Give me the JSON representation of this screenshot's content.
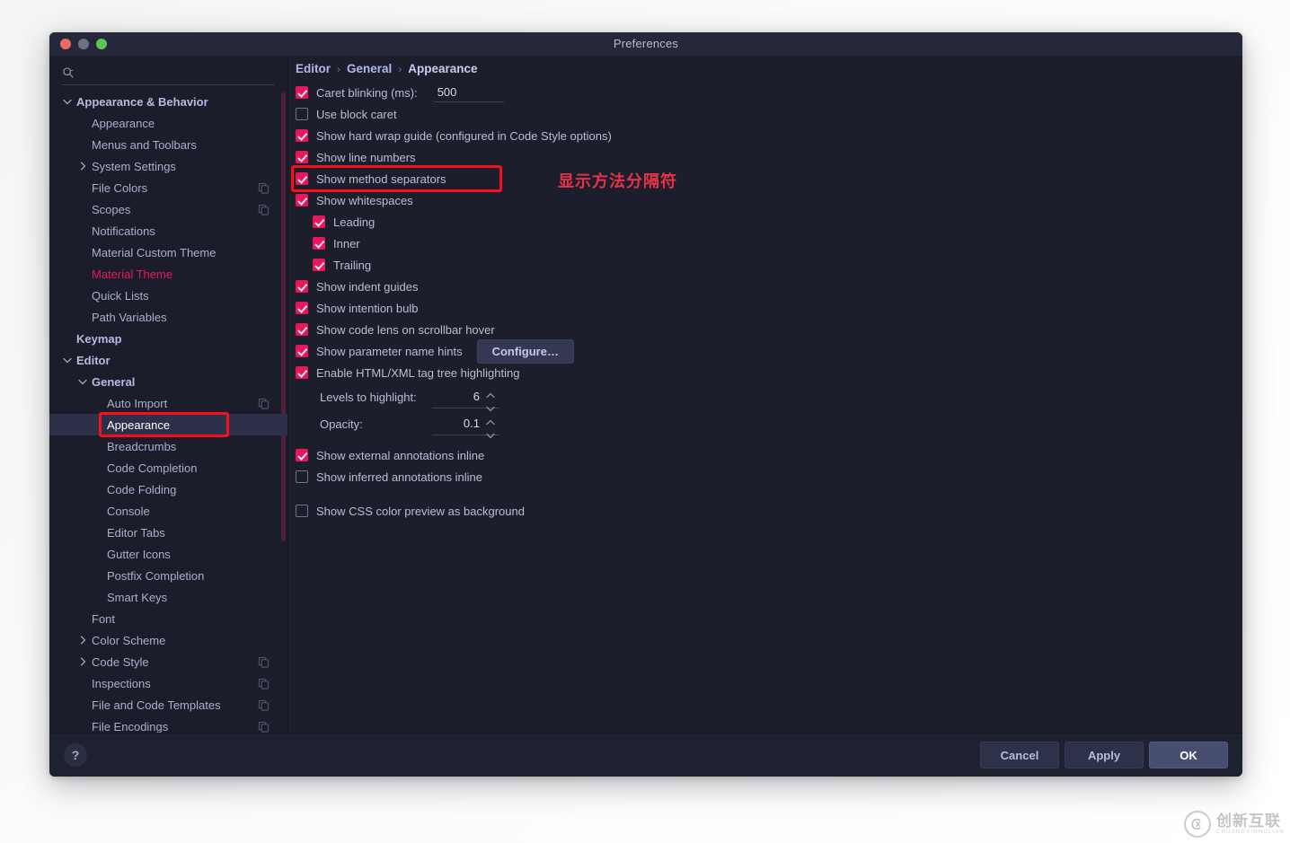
{
  "window": {
    "title": "Preferences",
    "traffic_lights": [
      "close-button",
      "minimize-button",
      "zoom-button"
    ]
  },
  "search": {
    "value": "",
    "placeholder": ""
  },
  "sidebar": {
    "items": [
      {
        "label": "Appearance & Behavior",
        "depth": 0,
        "bold": true,
        "chevron": "down",
        "icon": null,
        "selected": false,
        "accent": false
      },
      {
        "label": "Appearance",
        "depth": 1,
        "bold": false,
        "chevron": null,
        "icon": null,
        "selected": false,
        "accent": false
      },
      {
        "label": "Menus and Toolbars",
        "depth": 1,
        "bold": false,
        "chevron": null,
        "icon": null,
        "selected": false,
        "accent": false
      },
      {
        "label": "System Settings",
        "depth": 1,
        "bold": false,
        "chevron": "right",
        "icon": null,
        "selected": false,
        "accent": false
      },
      {
        "label": "File Colors",
        "depth": 1,
        "bold": false,
        "chevron": null,
        "icon": "copy-icon",
        "selected": false,
        "accent": false
      },
      {
        "label": "Scopes",
        "depth": 1,
        "bold": false,
        "chevron": null,
        "icon": "copy-icon",
        "selected": false,
        "accent": false
      },
      {
        "label": "Notifications",
        "depth": 1,
        "bold": false,
        "chevron": null,
        "icon": null,
        "selected": false,
        "accent": false
      },
      {
        "label": "Material Custom Theme",
        "depth": 1,
        "bold": false,
        "chevron": null,
        "icon": null,
        "selected": false,
        "accent": false
      },
      {
        "label": "Material Theme",
        "depth": 1,
        "bold": false,
        "chevron": null,
        "icon": null,
        "selected": false,
        "accent": true
      },
      {
        "label": "Quick Lists",
        "depth": 1,
        "bold": false,
        "chevron": null,
        "icon": null,
        "selected": false,
        "accent": false
      },
      {
        "label": "Path Variables",
        "depth": 1,
        "bold": false,
        "chevron": null,
        "icon": null,
        "selected": false,
        "accent": false
      },
      {
        "label": "Keymap",
        "depth": 0,
        "bold": true,
        "chevron": null,
        "icon": null,
        "selected": false,
        "accent": false
      },
      {
        "label": "Editor",
        "depth": 0,
        "bold": true,
        "chevron": "down",
        "icon": null,
        "selected": false,
        "accent": false
      },
      {
        "label": "General",
        "depth": 1,
        "bold": true,
        "chevron": "down",
        "icon": null,
        "selected": false,
        "accent": false
      },
      {
        "label": "Auto Import",
        "depth": 2,
        "bold": false,
        "chevron": null,
        "icon": "copy-icon",
        "selected": false,
        "accent": false
      },
      {
        "label": "Appearance",
        "depth": 2,
        "bold": false,
        "chevron": null,
        "icon": null,
        "selected": true,
        "accent": false
      },
      {
        "label": "Breadcrumbs",
        "depth": 2,
        "bold": false,
        "chevron": null,
        "icon": null,
        "selected": false,
        "accent": false
      },
      {
        "label": "Code Completion",
        "depth": 2,
        "bold": false,
        "chevron": null,
        "icon": null,
        "selected": false,
        "accent": false
      },
      {
        "label": "Code Folding",
        "depth": 2,
        "bold": false,
        "chevron": null,
        "icon": null,
        "selected": false,
        "accent": false
      },
      {
        "label": "Console",
        "depth": 2,
        "bold": false,
        "chevron": null,
        "icon": null,
        "selected": false,
        "accent": false
      },
      {
        "label": "Editor Tabs",
        "depth": 2,
        "bold": false,
        "chevron": null,
        "icon": null,
        "selected": false,
        "accent": false
      },
      {
        "label": "Gutter Icons",
        "depth": 2,
        "bold": false,
        "chevron": null,
        "icon": null,
        "selected": false,
        "accent": false
      },
      {
        "label": "Postfix Completion",
        "depth": 2,
        "bold": false,
        "chevron": null,
        "icon": null,
        "selected": false,
        "accent": false
      },
      {
        "label": "Smart Keys",
        "depth": 2,
        "bold": false,
        "chevron": null,
        "icon": null,
        "selected": false,
        "accent": false
      },
      {
        "label": "Font",
        "depth": 1,
        "bold": false,
        "chevron": null,
        "icon": null,
        "selected": false,
        "accent": false
      },
      {
        "label": "Color Scheme",
        "depth": 1,
        "bold": false,
        "chevron": "right",
        "icon": null,
        "selected": false,
        "accent": false
      },
      {
        "label": "Code Style",
        "depth": 1,
        "bold": false,
        "chevron": "right",
        "icon": "copy-icon",
        "selected": false,
        "accent": false
      },
      {
        "label": "Inspections",
        "depth": 1,
        "bold": false,
        "chevron": null,
        "icon": "copy-icon",
        "selected": false,
        "accent": false
      },
      {
        "label": "File and Code Templates",
        "depth": 1,
        "bold": false,
        "chevron": null,
        "icon": "copy-icon",
        "selected": false,
        "accent": false
      },
      {
        "label": "File Encodings",
        "depth": 1,
        "bold": false,
        "chevron": null,
        "icon": "copy-icon",
        "selected": false,
        "accent": false
      }
    ]
  },
  "breadcrumb": {
    "parts": [
      "Editor",
      "General",
      "Appearance"
    ],
    "separator": "›"
  },
  "options": [
    {
      "kind": "checkbox",
      "label": "Caret blinking (ms):",
      "checked": true,
      "indent": 0,
      "field": "500"
    },
    {
      "kind": "checkbox",
      "label": "Use block caret",
      "checked": false,
      "indent": 0
    },
    {
      "kind": "checkbox",
      "label": "Show hard wrap guide (configured in Code Style options)",
      "checked": true,
      "indent": 0
    },
    {
      "kind": "checkbox",
      "label": "Show line numbers",
      "checked": true,
      "indent": 0
    },
    {
      "kind": "checkbox",
      "label": "Show method separators",
      "checked": true,
      "indent": 0,
      "highlighted": true
    },
    {
      "kind": "checkbox",
      "label": "Show whitespaces",
      "checked": true,
      "indent": 0
    },
    {
      "kind": "checkbox",
      "label": "Leading",
      "checked": true,
      "indent": 1
    },
    {
      "kind": "checkbox",
      "label": "Inner",
      "checked": true,
      "indent": 1
    },
    {
      "kind": "checkbox",
      "label": "Trailing",
      "checked": true,
      "indent": 1
    },
    {
      "kind": "checkbox",
      "label": "Show indent guides",
      "checked": true,
      "indent": 0
    },
    {
      "kind": "checkbox",
      "label": "Show intention bulb",
      "checked": true,
      "indent": 0
    },
    {
      "kind": "checkbox",
      "label": "Show code lens on scrollbar hover",
      "checked": true,
      "indent": 0
    },
    {
      "kind": "checkbox",
      "label": "Show parameter name hints",
      "checked": true,
      "indent": 0,
      "button": "Configure…"
    },
    {
      "kind": "checkbox",
      "label": "Enable HTML/XML tag tree highlighting",
      "checked": true,
      "indent": 0
    }
  ],
  "spinners": [
    {
      "label": "Levels to highlight:",
      "value": "6"
    },
    {
      "label": "Opacity:",
      "value": "0.1"
    }
  ],
  "options_tail": [
    {
      "kind": "checkbox",
      "label": "Show external annotations inline",
      "checked": true,
      "indent": 0
    },
    {
      "kind": "checkbox",
      "label": "Show inferred annotations inline",
      "checked": false,
      "indent": 0
    },
    {
      "kind": "spacer"
    },
    {
      "kind": "checkbox",
      "label": "Show CSS color preview as background",
      "checked": false,
      "indent": 0
    }
  ],
  "annotation": {
    "text": "显示方法分隔符",
    "color": "#e8324a"
  },
  "footer": {
    "help_label": "?",
    "cancel_label": "Cancel",
    "apply_label": "Apply",
    "ok_label": "OK"
  },
  "watermark": {
    "glyph": "ⓧ",
    "cn": "创新互联",
    "en": "CHUANGXINHULIAN"
  },
  "colors": {
    "accent": "#e8175d",
    "highlight": "#fb0d1b",
    "window_bg": "#1c1f2b",
    "sidebar_bg": "#1b1e2a",
    "selected_row": "#2c3048"
  }
}
